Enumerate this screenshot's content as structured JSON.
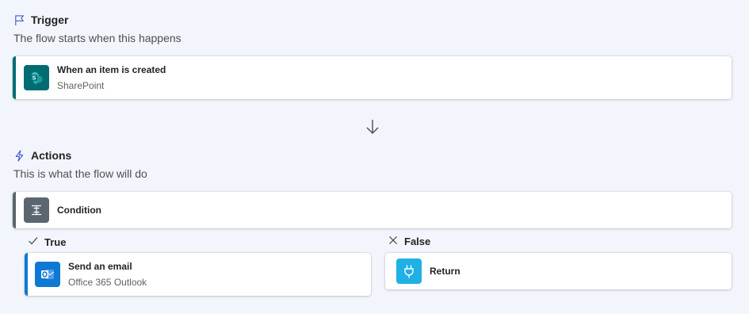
{
  "trigger": {
    "title": "Trigger",
    "subtitle": "The flow starts when this happens",
    "icon": "flag-icon",
    "card": {
      "title": "When an item is created",
      "subtitle": "SharePoint",
      "icon": "sharepoint-icon",
      "tile_color": "#036c70",
      "accent_color": "#036c70"
    }
  },
  "connector": {
    "icon": "arrow-down-icon"
  },
  "actions": {
    "title": "Actions",
    "subtitle": "This is what the flow will do",
    "icon": "lightning-icon",
    "condition": {
      "title": "Condition",
      "icon": "condition-icon",
      "tile_color": "#5c6670",
      "accent_color": "#5c6670"
    },
    "true_branch": {
      "label": "True",
      "icon": "checkmark-icon",
      "card": {
        "title": "Send an email",
        "subtitle": "Office 365 Outlook",
        "icon": "outlook-icon",
        "tile_color": "#0f78d4",
        "accent_color": "#0f78d4"
      }
    },
    "false_branch": {
      "label": "False",
      "icon": "close-icon",
      "card": {
        "title": "Return",
        "icon": "plug-icon",
        "tile_color": "#1fb0e6"
      }
    }
  },
  "colors": {
    "background": "#f2f5fc",
    "section_icon": "#3d5cc9"
  }
}
